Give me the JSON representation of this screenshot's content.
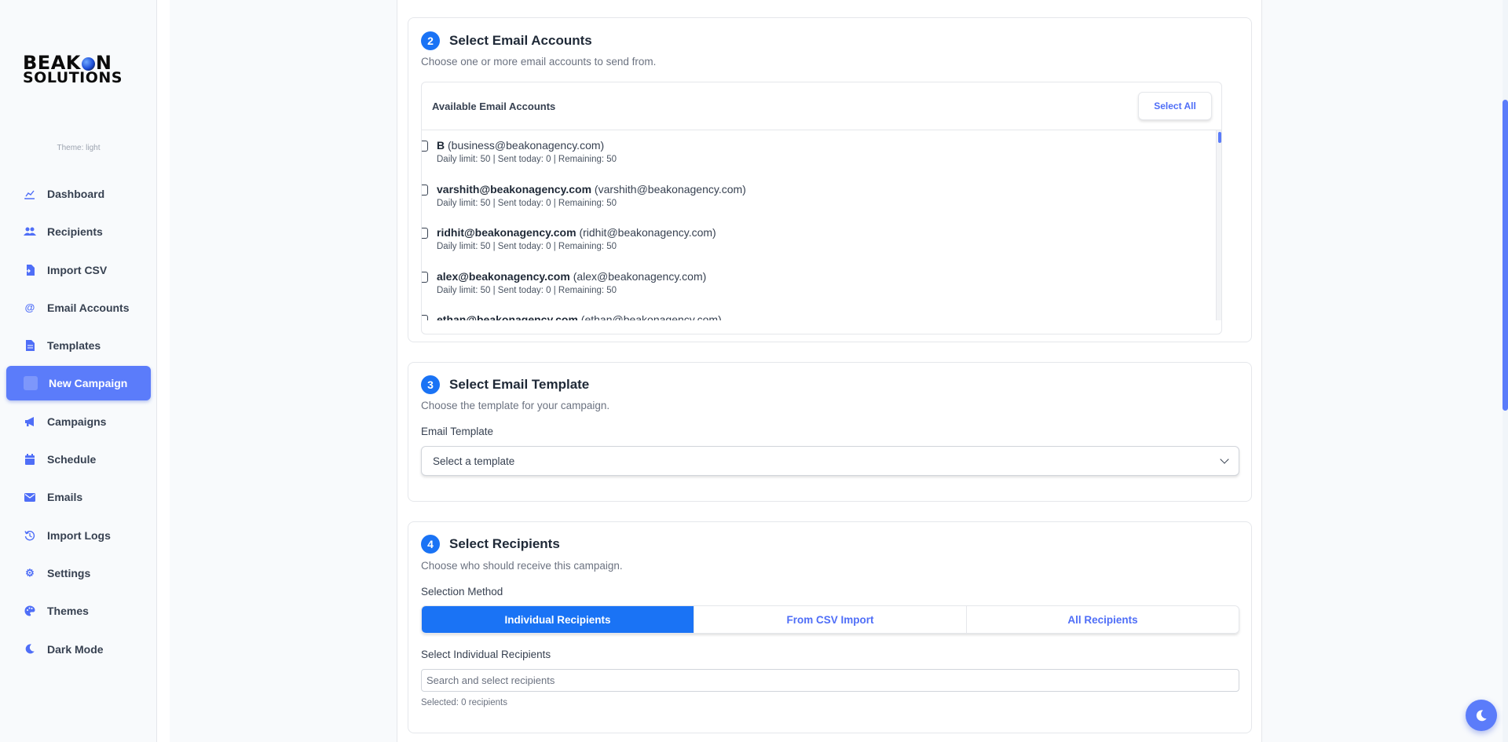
{
  "brand": {
    "line1_a": "BEAK",
    "line1_b": "N",
    "line2": "SOLUTIONS"
  },
  "sidebar": {
    "theme_label": "Theme: light",
    "items": [
      {
        "label": "Dashboard",
        "icon": "chart-line-icon"
      },
      {
        "label": "Recipients",
        "icon": "users-icon"
      },
      {
        "label": "Import CSV",
        "icon": "file-import-icon"
      },
      {
        "label": "Email Accounts",
        "icon": "at-icon"
      },
      {
        "label": "Templates",
        "icon": "file-icon"
      },
      {
        "label": "New Campaign",
        "icon": "paper-plane-icon",
        "active": true
      },
      {
        "label": "Campaigns",
        "icon": "megaphone-icon"
      },
      {
        "label": "Schedule",
        "icon": "calendar-icon"
      },
      {
        "label": "Emails",
        "icon": "envelope-icon"
      },
      {
        "label": "Import Logs",
        "icon": "history-icon"
      },
      {
        "label": "Settings",
        "icon": "gear-icon"
      },
      {
        "label": "Themes",
        "icon": "palette-icon"
      },
      {
        "label": "Dark Mode",
        "icon": "moon-icon"
      }
    ]
  },
  "section2": {
    "step": "2",
    "title": "Select Email Accounts",
    "subtitle": "Choose one or more email accounts to send from.",
    "box_title": "Available Email Accounts",
    "select_all": "Select All",
    "accounts": [
      {
        "name": "B",
        "email": "(business@beakonagency.com)",
        "meta": "Daily limit: 50 | Sent today: 0 | Remaining: 50"
      },
      {
        "name": "varshith@beakonagency.com",
        "email": "(varshith@beakonagency.com)",
        "meta": "Daily limit: 50 | Sent today: 0 | Remaining: 50"
      },
      {
        "name": "ridhit@beakonagency.com",
        "email": "(ridhit@beakonagency.com)",
        "meta": "Daily limit: 50 | Sent today: 0 | Remaining: 50"
      },
      {
        "name": "alex@beakonagency.com",
        "email": "(alex@beakonagency.com)",
        "meta": "Daily limit: 50 | Sent today: 0 | Remaining: 50"
      },
      {
        "name": "ethan@beakonagency.com",
        "email": "(ethan@beakonagency.com)",
        "meta": ""
      }
    ]
  },
  "section3": {
    "step": "3",
    "title": "Select Email Template",
    "subtitle": "Choose the template for your campaign.",
    "field_label": "Email Template",
    "select_value": "Select a template"
  },
  "section4": {
    "step": "4",
    "title": "Select Recipients",
    "subtitle": "Choose who should receive this campaign.",
    "method_label": "Selection Method",
    "methods": [
      "Individual Recipients",
      "From CSV Import",
      "All Recipients"
    ],
    "individual_label": "Select Individual Recipients",
    "search_placeholder": "Search and select recipients",
    "selected_count": "Selected: 0 recipients"
  },
  "colors": {
    "accent": "#1a73f5",
    "brand": "#5b7cfa"
  }
}
